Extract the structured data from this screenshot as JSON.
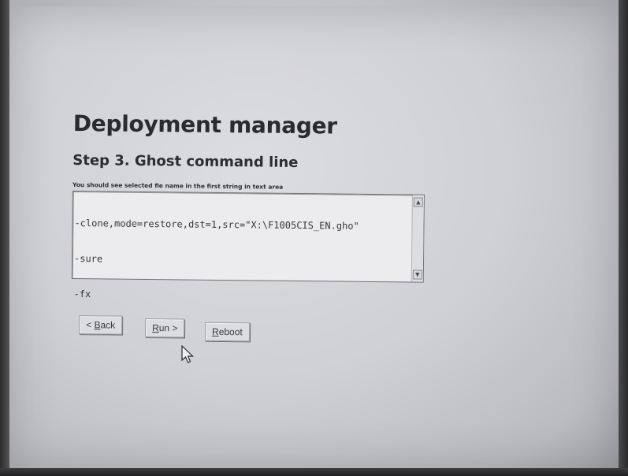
{
  "page": {
    "title": "Deployment manager",
    "step_title": "Step 3. Ghost command line",
    "hint": "You should see selected fie name in the first string in text area"
  },
  "command_textarea": {
    "lines": [
      "-clone,mode=restore,dst=1,src=\"X:\\F1005CIS_EN.gho\"",
      "-sure",
      "-fx"
    ],
    "scroll_up_icon": "arrow-up-icon",
    "scroll_down_icon": "arrow-down-icon"
  },
  "buttons": {
    "back": {
      "prefix": "< ",
      "accel": "B",
      "rest": "ack"
    },
    "run": {
      "accel": "R",
      "rest": "un >"
    },
    "reboot": {
      "accel": "R",
      "rest": "eboot"
    }
  },
  "cursor_icon": "mouse-pointer-icon"
}
